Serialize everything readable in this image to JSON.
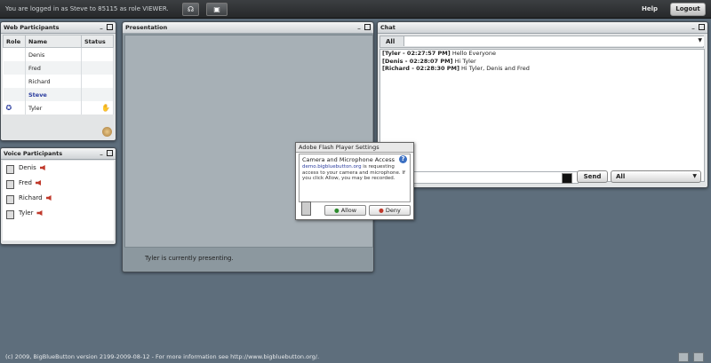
{
  "topbar": {
    "status": "You are logged in as Steve to 85115 as role VIEWER.",
    "help": "Help",
    "logout": "Logout"
  },
  "web_participants": {
    "title": "Web Participants",
    "columns": [
      "Role",
      "Name",
      "Status"
    ],
    "rows": [
      {
        "name": "Denis"
      },
      {
        "name": "Fred"
      },
      {
        "name": "Richard"
      },
      {
        "name": "Steve"
      },
      {
        "name": "Tyler"
      }
    ]
  },
  "voice_participants": {
    "title": "Voice Participants",
    "items": [
      {
        "name": "Denis"
      },
      {
        "name": "Fred"
      },
      {
        "name": "Richard"
      },
      {
        "name": "Tyler"
      }
    ]
  },
  "presentation": {
    "title": "Presentation",
    "status": "Tyler is currently presenting."
  },
  "chat": {
    "title": "Chat",
    "filter": "All",
    "messages": [
      {
        "sender": "[Tyler - 02:27:57 PM]",
        "text": "Hello Everyone"
      },
      {
        "sender": "[Denis - 02:28:07 PM]",
        "text": "Hi Tyler"
      },
      {
        "sender": "[Richard - 02:28:30 PM]",
        "text": "Hi Tyler, Denis and Fred"
      }
    ],
    "send": "Send",
    "recipient": "All"
  },
  "flash_dialog": {
    "title": "Adobe Flash Player Settings",
    "heading": "Camera and Microphone Access",
    "link": "demo.bigbluebutton.org",
    "body1": " is requesting access to your camera and microphone. If you click Allow, you may be recorded.",
    "allow": "Allow",
    "deny": "Deny"
  },
  "footer": {
    "text": "(c) 2009, BigBlueButton version 2199-2009-08-12 - For more information see http://www.bigbluebutton.org/."
  }
}
